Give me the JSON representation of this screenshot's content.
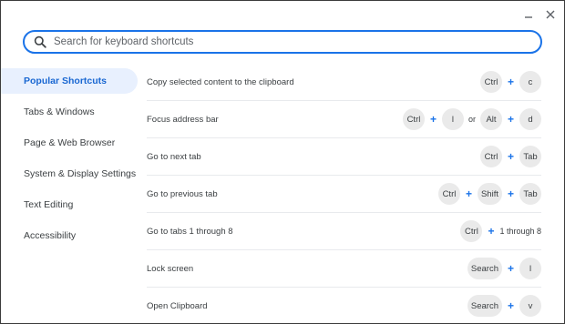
{
  "window": {
    "minimize_icon": "minimize-icon",
    "close_icon": "close-icon"
  },
  "search": {
    "placeholder": "Search for keyboard shortcuts",
    "icon": "search-icon",
    "accent_color": "#1a73e8"
  },
  "sidebar": {
    "items": [
      {
        "label": "Popular Shortcuts",
        "active": true
      },
      {
        "label": "Tabs & Windows",
        "active": false
      },
      {
        "label": "Page & Web Browser",
        "active": false
      },
      {
        "label": "System & Display Settings",
        "active": false
      },
      {
        "label": "Text Editing",
        "active": false
      },
      {
        "label": "Accessibility",
        "active": false
      }
    ]
  },
  "shortcuts": [
    {
      "description": "Copy selected content to the clipboard",
      "keys": [
        {
          "k": "key",
          "v": "Ctrl"
        },
        {
          "k": "plus",
          "v": "+"
        },
        {
          "k": "key",
          "v": "c"
        }
      ]
    },
    {
      "description": "Focus address bar",
      "keys": [
        {
          "k": "key",
          "v": "Ctrl"
        },
        {
          "k": "plus",
          "v": "+"
        },
        {
          "k": "key",
          "v": "l"
        },
        {
          "k": "sep",
          "v": "or"
        },
        {
          "k": "key",
          "v": "Alt"
        },
        {
          "k": "plus",
          "v": "+"
        },
        {
          "k": "key",
          "v": "d"
        }
      ]
    },
    {
      "description": "Go to next tab",
      "keys": [
        {
          "k": "key",
          "v": "Ctrl"
        },
        {
          "k": "plus",
          "v": "+"
        },
        {
          "k": "key",
          "v": "Tab"
        }
      ]
    },
    {
      "description": "Go to previous tab",
      "keys": [
        {
          "k": "key",
          "v": "Ctrl"
        },
        {
          "k": "plus",
          "v": "+"
        },
        {
          "k": "key",
          "v": "Shift"
        },
        {
          "k": "plus",
          "v": "+"
        },
        {
          "k": "key",
          "v": "Tab"
        }
      ]
    },
    {
      "description": "Go to tabs 1 through 8",
      "keys": [
        {
          "k": "key",
          "v": "Ctrl"
        },
        {
          "k": "plus",
          "v": "+"
        },
        {
          "k": "txt",
          "v": "1 through 8"
        }
      ]
    },
    {
      "description": "Lock screen",
      "keys": [
        {
          "k": "key",
          "v": "Search"
        },
        {
          "k": "plus",
          "v": "+"
        },
        {
          "k": "key",
          "v": "l"
        }
      ]
    },
    {
      "description": "Open Clipboard",
      "keys": [
        {
          "k": "key",
          "v": "Search"
        },
        {
          "k": "plus",
          "v": "+"
        },
        {
          "k": "key",
          "v": "v"
        }
      ]
    }
  ]
}
